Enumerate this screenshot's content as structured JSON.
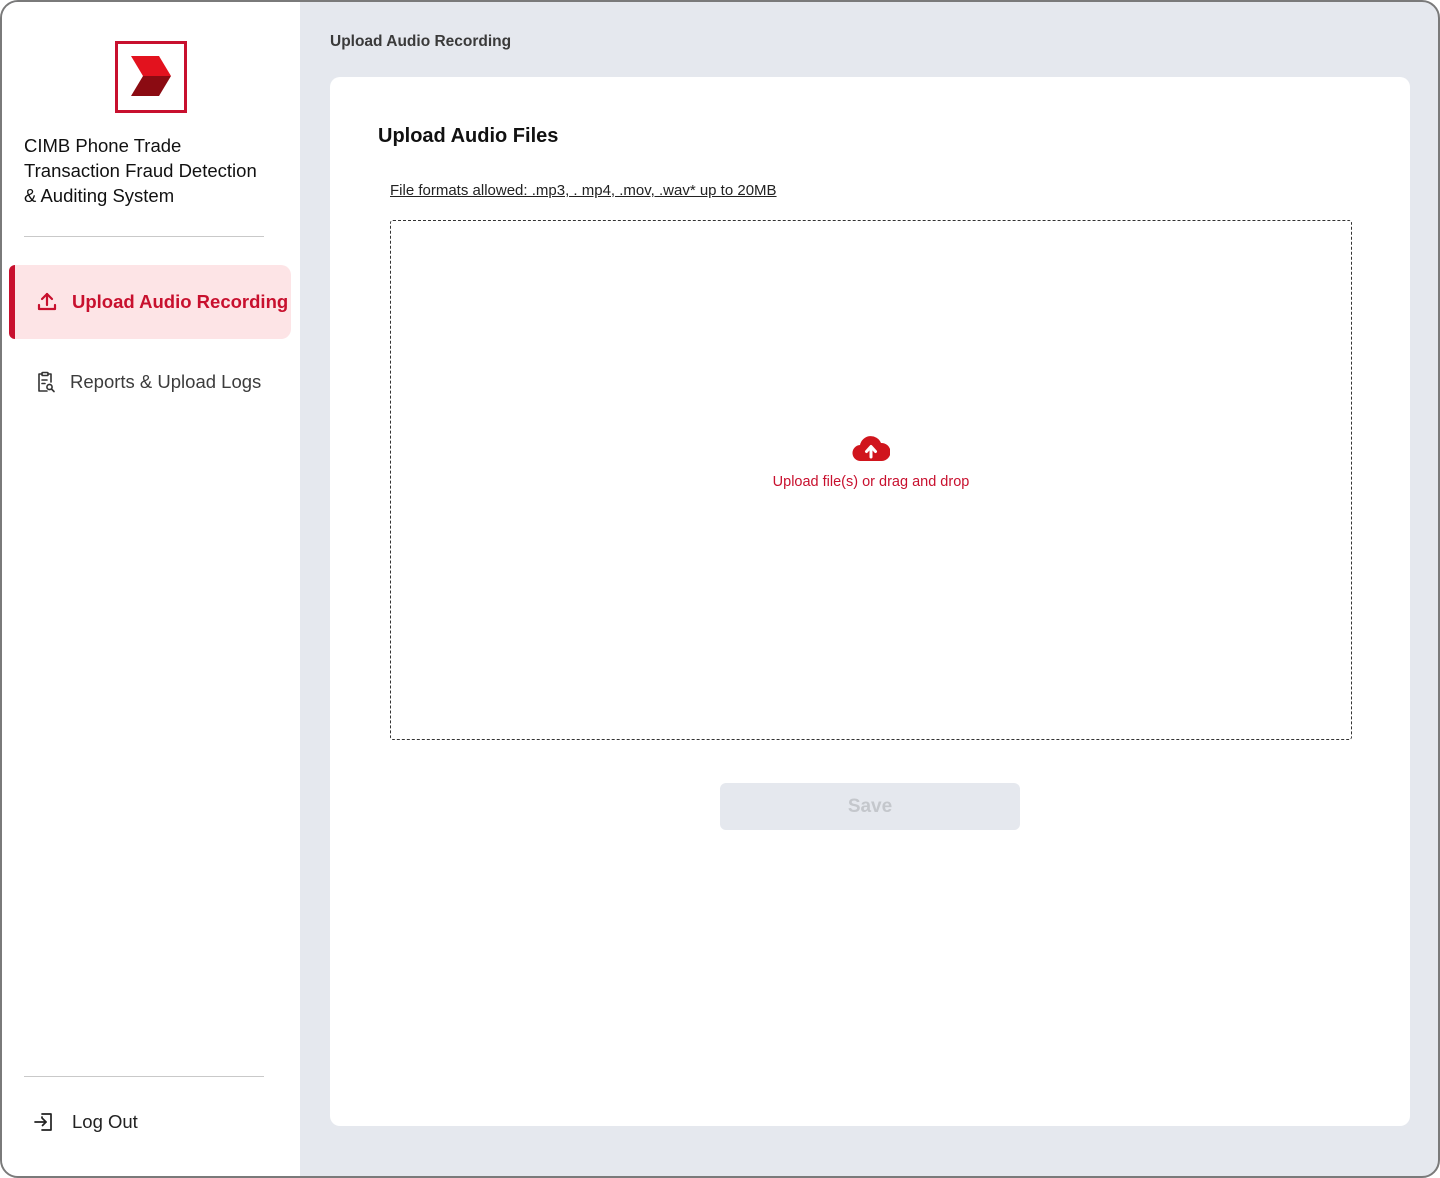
{
  "app": {
    "title": "CIMB Phone Trade\nTransaction Fraud Detection\n& Auditing System",
    "brand_color": "#c8102e"
  },
  "sidebar": {
    "items": [
      {
        "label": "Upload Audio Recording",
        "icon": "upload-icon",
        "active": true
      },
      {
        "label": "Reports & Upload Logs",
        "icon": "clipboard-search-icon",
        "active": false
      }
    ],
    "logout_label": "Log Out",
    "logout_icon": "logout-icon"
  },
  "header": {
    "breadcrumb": "Upload Audio Recording"
  },
  "main": {
    "title": "Upload Audio Files",
    "formats_note": "File formats allowed: .mp3, . mp4, .mov, .wav*  up to 20MB",
    "dropzone": {
      "icon": "cloud-upload-icon",
      "label": "Upload file(s) or drag and drop"
    },
    "save_label": "Save",
    "save_disabled": true
  }
}
